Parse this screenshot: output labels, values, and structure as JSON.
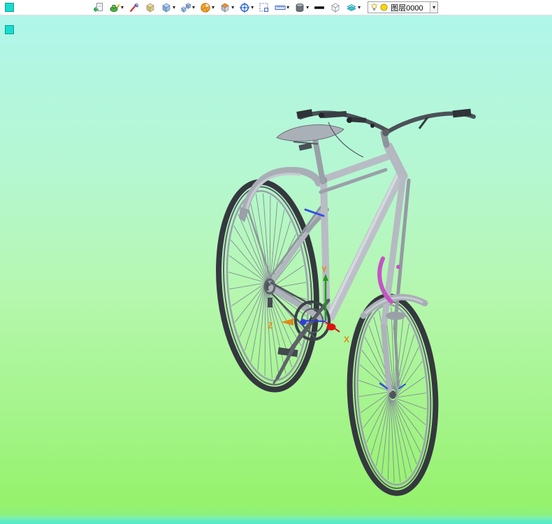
{
  "toolbar": {
    "dropdown_glyph": "▾",
    "items": [
      {
        "name": "open-document",
        "icon": "open",
        "dropdown": false
      },
      {
        "name": "render-material",
        "icon": "paint",
        "dropdown": true
      },
      {
        "name": "sketch-knife",
        "icon": "knife",
        "dropdown": false
      },
      {
        "name": "solid-primitive",
        "icon": "cube_tan",
        "dropdown": false
      },
      {
        "name": "feature-cube",
        "icon": "cube_blue",
        "dropdown": true
      },
      {
        "name": "boolean-operations",
        "icon": "cubes",
        "dropdown": true
      },
      {
        "name": "pattern-wheel",
        "icon": "pie",
        "dropdown": true
      },
      {
        "name": "extrude-feature",
        "icon": "cube_orange",
        "dropdown": true
      },
      {
        "name": "datum-target",
        "icon": "target",
        "dropdown": true
      },
      {
        "name": "selection-box",
        "icon": "select",
        "dropdown": false
      },
      {
        "name": "measure-ruler",
        "icon": "ruler",
        "dropdown": true
      },
      {
        "name": "appearance-cylinder",
        "icon": "cylinder",
        "dropdown": true
      },
      {
        "name": "line-width",
        "icon": "blackbar",
        "dropdown": false
      },
      {
        "name": "wireframe-display",
        "icon": "wirecube",
        "dropdown": false
      },
      {
        "name": "display-layers",
        "icon": "layers",
        "dropdown": true
      }
    ],
    "layer_combo": {
      "value": "图层0000"
    }
  },
  "viewport": {
    "triad": {
      "x_label": "X",
      "y_label": "Y",
      "z_label": "Z"
    }
  },
  "colors": {
    "background_top": "#b0f6ea",
    "background_bottom": "#95f26c",
    "toolbar_bg": "#ffffff",
    "accent_teal": "#17ddcf",
    "layer_swatch_yellow": "#ffd800",
    "triad_label_orange": "#e0891a",
    "model_gray": "#b8bcc4"
  }
}
